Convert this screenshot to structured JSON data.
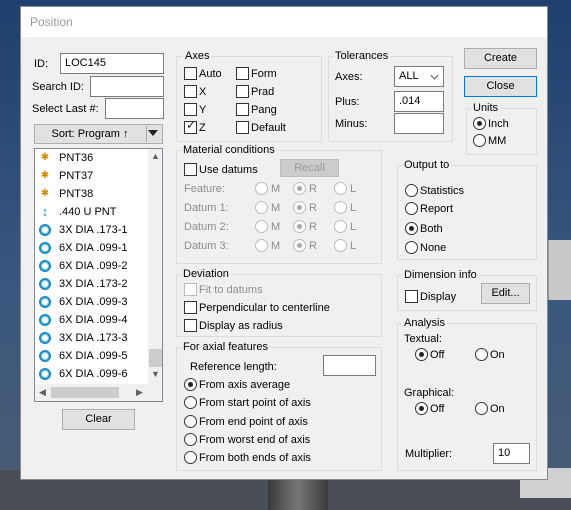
{
  "window": {
    "title": "Position"
  },
  "ident": {
    "id_label": "ID:",
    "id_value": "LOC145",
    "search_label": "Search ID:",
    "search_value": "",
    "select_last_label": "Select Last #:",
    "select_last_value": ""
  },
  "sort": {
    "label": "Sort: Program ↑"
  },
  "feature_list": {
    "items": [
      {
        "icon": "point-icon",
        "label": "PNT36"
      },
      {
        "icon": "point-icon",
        "label": "PNT37"
      },
      {
        "icon": "point-icon",
        "label": "PNT38"
      },
      {
        "icon": "u-point-icon",
        "label": ".440 U PNT"
      },
      {
        "icon": "circle-icon",
        "label": "3X DIA .173-1"
      },
      {
        "icon": "circle-icon",
        "label": "6X DIA .099-1"
      },
      {
        "icon": "circle-icon",
        "label": "6X DIA .099-2"
      },
      {
        "icon": "circle-icon",
        "label": "3X DIA .173-2"
      },
      {
        "icon": "circle-icon",
        "label": "6X DIA .099-3"
      },
      {
        "icon": "circle-icon",
        "label": "6X DIA .099-4"
      },
      {
        "icon": "circle-icon",
        "label": "3X DIA .173-3"
      },
      {
        "icon": "circle-icon",
        "label": "6X DIA .099-5"
      },
      {
        "icon": "circle-icon",
        "label": "6X DIA .099-6"
      }
    ]
  },
  "clear_button": "Clear",
  "axes": {
    "title": "Axes",
    "items": [
      {
        "label": "Auto",
        "checked": false
      },
      {
        "label": "X",
        "checked": false
      },
      {
        "label": "Y",
        "checked": false
      },
      {
        "label": "Z",
        "checked": true
      },
      {
        "label": "Form",
        "checked": false
      },
      {
        "label": "Prad",
        "checked": false
      },
      {
        "label": "Pang",
        "checked": false
      },
      {
        "label": "Default",
        "checked": false
      }
    ]
  },
  "tolerances": {
    "title": "Tolerances",
    "axes_label": "Axes:",
    "axes_value": "ALL",
    "plus_label": "Plus:",
    "plus_value": ".014",
    "minus_label": "Minus:",
    "minus_value": ""
  },
  "buttons": {
    "create": "Create",
    "close": "Close",
    "recall": "Recall",
    "edit": "Edit..."
  },
  "units": {
    "title": "Units",
    "inch": "Inch",
    "mm": "MM",
    "selected": "Inch"
  },
  "material_conditions": {
    "title": "Material conditions",
    "use_datums": "Use datums",
    "rows": [
      {
        "label": "Feature:",
        "m": "M",
        "r": "R",
        "l": "L"
      },
      {
        "label": "Datum 1:",
        "m": "M",
        "r": "R",
        "l": "L"
      },
      {
        "label": "Datum 2:",
        "m": "M",
        "r": "R",
        "l": "L"
      },
      {
        "label": "Datum 3:",
        "m": "M",
        "r": "R",
        "l": "L"
      }
    ]
  },
  "output_to": {
    "title": "Output to",
    "options": [
      "Statistics",
      "Report",
      "Both",
      "None"
    ],
    "selected": "Both"
  },
  "deviation": {
    "title": "Deviation",
    "fit_to_datums": "Fit to datums",
    "perpendicular": "Perpendicular to centerline",
    "display_radius": "Display as radius"
  },
  "dimension_info": {
    "title": "Dimension info",
    "display": "Display"
  },
  "axial_features": {
    "title": "For axial features",
    "reference_length_label": "Reference length:",
    "reference_length_value": "",
    "options": [
      "From axis average",
      "From start point of axis",
      "From end point of axis",
      "From worst end of axis",
      "From both ends of axis"
    ],
    "selected": "From axis average"
  },
  "analysis": {
    "title": "Analysis",
    "textual_label": "Textual:",
    "textual_off": "Off",
    "textual_on": "On",
    "textual_selected": "Off",
    "graphical_label": "Graphical:",
    "graphical_off": "Off",
    "graphical_on": "On",
    "graphical_selected": "Off",
    "multiplier_label": "Multiplier:",
    "multiplier_value": "10"
  }
}
